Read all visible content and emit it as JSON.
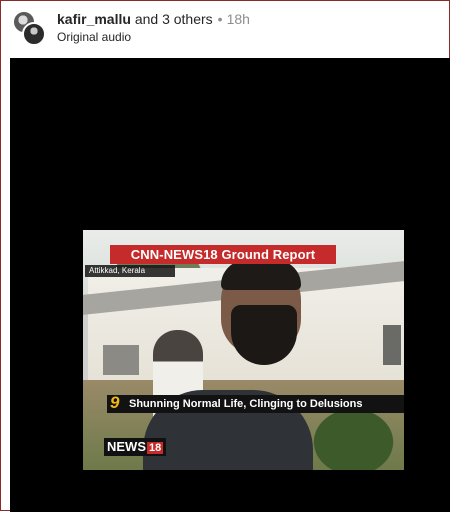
{
  "post": {
    "username": "kafir_mallu",
    "collaborators": "and 3 others",
    "separator": "•",
    "time": "18h",
    "audio": "Original audio"
  },
  "video": {
    "banner": "CNN-NEWS18 Ground Report",
    "location": "Attikkad, Kerala",
    "ticker": "Shunning Normal Life, Clinging to Delusions",
    "ticker_logo": "9",
    "channel_name": "NEWS",
    "channel_number": "18"
  },
  "colors": {
    "banner_red": "#c62b2b",
    "video_background": "#000000",
    "ticker_logo_gold": "#f1b81a"
  }
}
